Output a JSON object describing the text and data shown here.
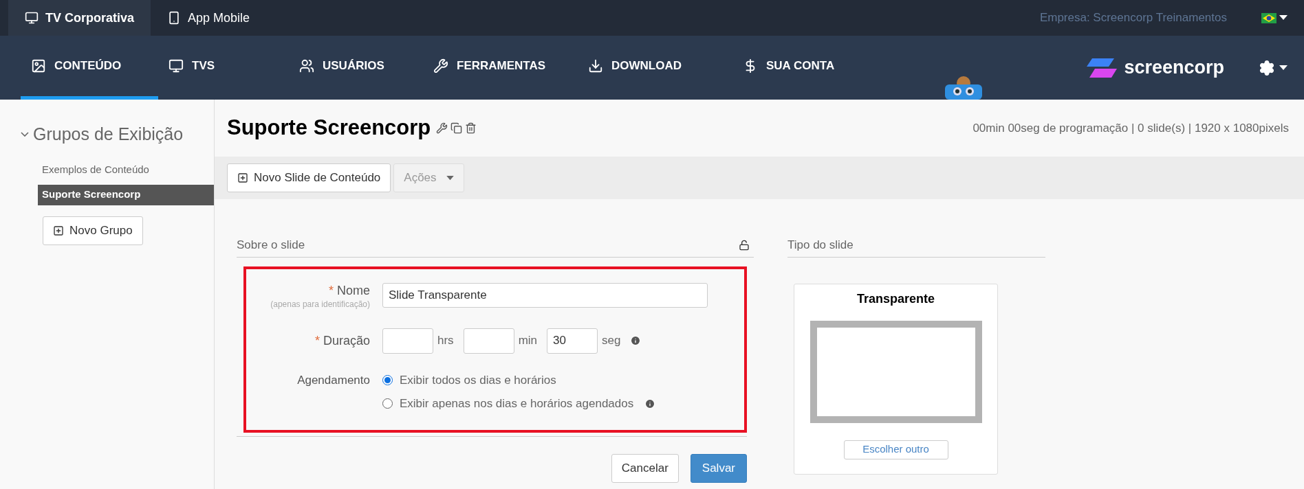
{
  "top_tabs": [
    {
      "label": "TV Corporativa",
      "selected": true
    },
    {
      "label": "App Mobile",
      "selected": false
    }
  ],
  "company": "Empresa: Screencorp Treinamentos",
  "nav": [
    {
      "label": "CONTEÚDO",
      "selected": true
    },
    {
      "label": "TVS",
      "selected": false
    },
    {
      "label": "USUÁRIOS",
      "selected": false
    },
    {
      "label": "FERRAMENTAS",
      "selected": false
    },
    {
      "label": "DOWNLOAD",
      "selected": false
    },
    {
      "label": "SUA CONTA",
      "selected": false
    }
  ],
  "logo": "screencorp",
  "sidebar": {
    "title": "Grupos de Exibição",
    "expanded": true,
    "items": [
      {
        "label": "Exemplos de Conteúdo",
        "selected": false
      },
      {
        "label": "Suporte Screencorp",
        "selected": true
      }
    ],
    "new_button": "Novo Grupo"
  },
  "header": {
    "title": "Suporte Screencorp",
    "info": "00min 00seg de programação | 0 slide(s) | 1920 x 1080pixels"
  },
  "toolbar": {
    "new_slide": "Novo Slide de Conteúdo",
    "actions": "Ações"
  },
  "form": {
    "section": "Sobre o slide",
    "locked": false,
    "required_mark": "*",
    "name_label": "Nome",
    "name_hint": "(apenas para identificação)",
    "name_value": "Slide Transparente",
    "duration_label": "Duração",
    "duration": [
      {
        "unit": "hrs"
      },
      {
        "unit": "min"
      },
      {
        "value": "30",
        "unit": "seg"
      }
    ],
    "schedule_label": "Agendamento",
    "schedule": [
      {
        "label": "Exibir todos os dias e horários",
        "selected": true,
        "info": false
      },
      {
        "label": "Exibir apenas nos dias e horários agendados",
        "selected": false,
        "info": true
      }
    ],
    "cancel": "Cancelar",
    "save": "Salvar"
  },
  "slide_type": {
    "section": "Tipo do slide",
    "card_title": "Transparente",
    "choose": "Escolher outro"
  }
}
